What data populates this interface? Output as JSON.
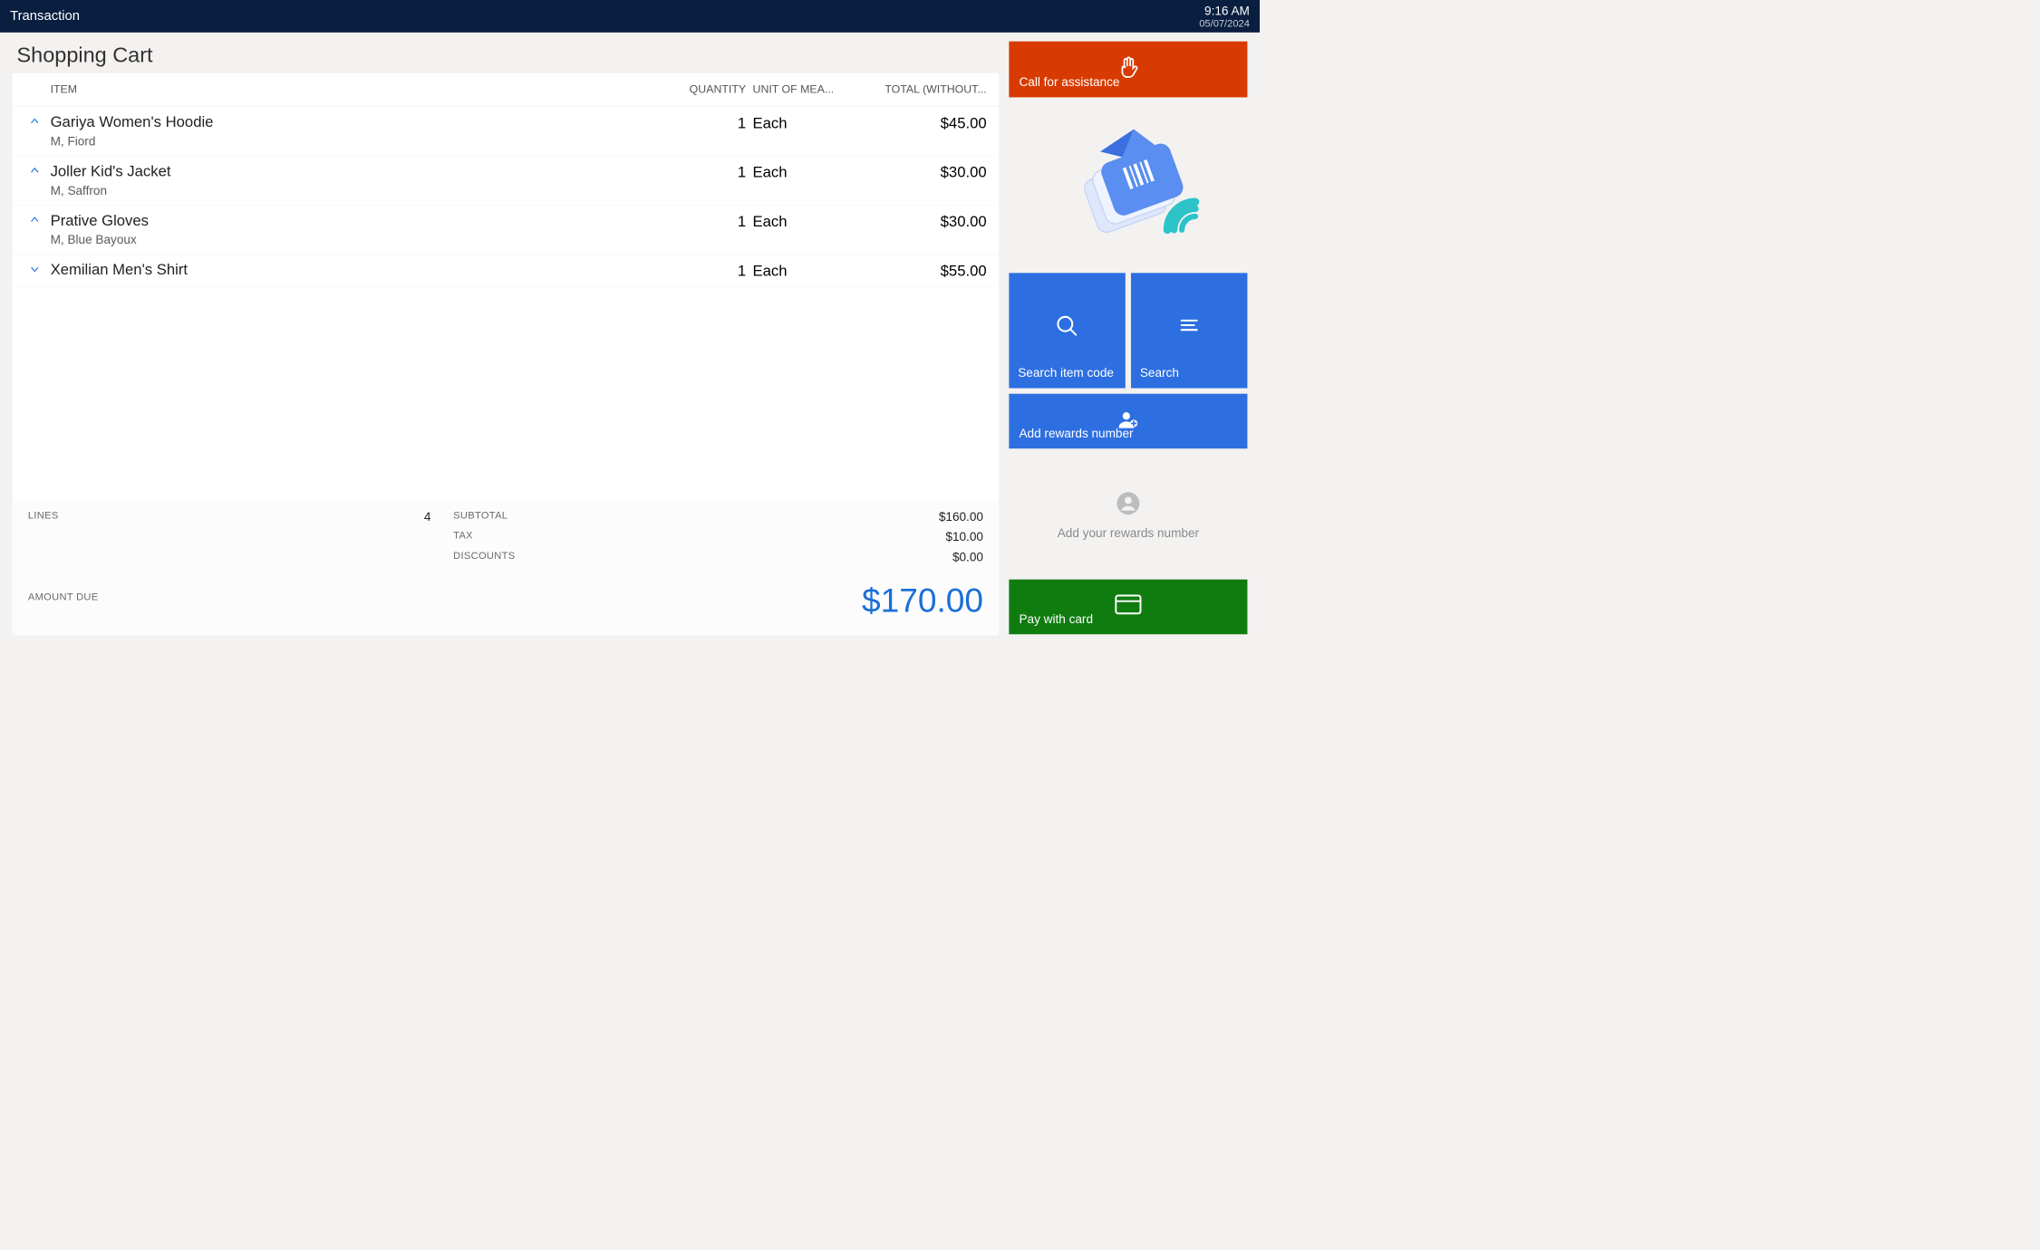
{
  "topbar": {
    "title": "Transaction",
    "time": "9:16 AM",
    "date": "05/07/2024"
  },
  "page": {
    "title": "Shopping Cart"
  },
  "columns": {
    "item": "ITEM",
    "quantity": "QUANTITY",
    "unit": "UNIT OF MEA...",
    "total": "TOTAL (WITHOUT..."
  },
  "items": [
    {
      "name": "Gariya Women's Hoodie",
      "sub": "M, Fiord",
      "qty": "1",
      "unit": "Each",
      "total": "$45.00",
      "expanded": true
    },
    {
      "name": "Joller Kid's Jacket",
      "sub": "M, Saffron",
      "qty": "1",
      "unit": "Each",
      "total": "$30.00",
      "expanded": true
    },
    {
      "name": "Prative Gloves",
      "sub": "M, Blue Bayoux",
      "qty": "1",
      "unit": "Each",
      "total": "$30.00",
      "expanded": true
    },
    {
      "name": "Xemilian Men's Shirt",
      "sub": "",
      "qty": "1",
      "unit": "Each",
      "total": "$55.00",
      "expanded": false
    }
  ],
  "totals": {
    "lines_label": "LINES",
    "lines_value": "4",
    "subtotal_label": "SUBTOTAL",
    "subtotal": "$160.00",
    "tax_label": "TAX",
    "tax": "$10.00",
    "discounts_label": "DISCOUNTS",
    "discounts": "$0.00",
    "amount_due_label": "AMOUNT DUE",
    "amount_due": "$170.00"
  },
  "actions": {
    "assist": "Call for assistance",
    "search_item": "Search item code",
    "search": "Search",
    "add_rewards": "Add rewards number",
    "rewards_prompt": "Add your rewards number",
    "pay": "Pay with card"
  },
  "colors": {
    "primary": "#2d6fe0",
    "assist": "#d83b01",
    "pay": "#107c10",
    "topbar": "#0a1e3f"
  }
}
